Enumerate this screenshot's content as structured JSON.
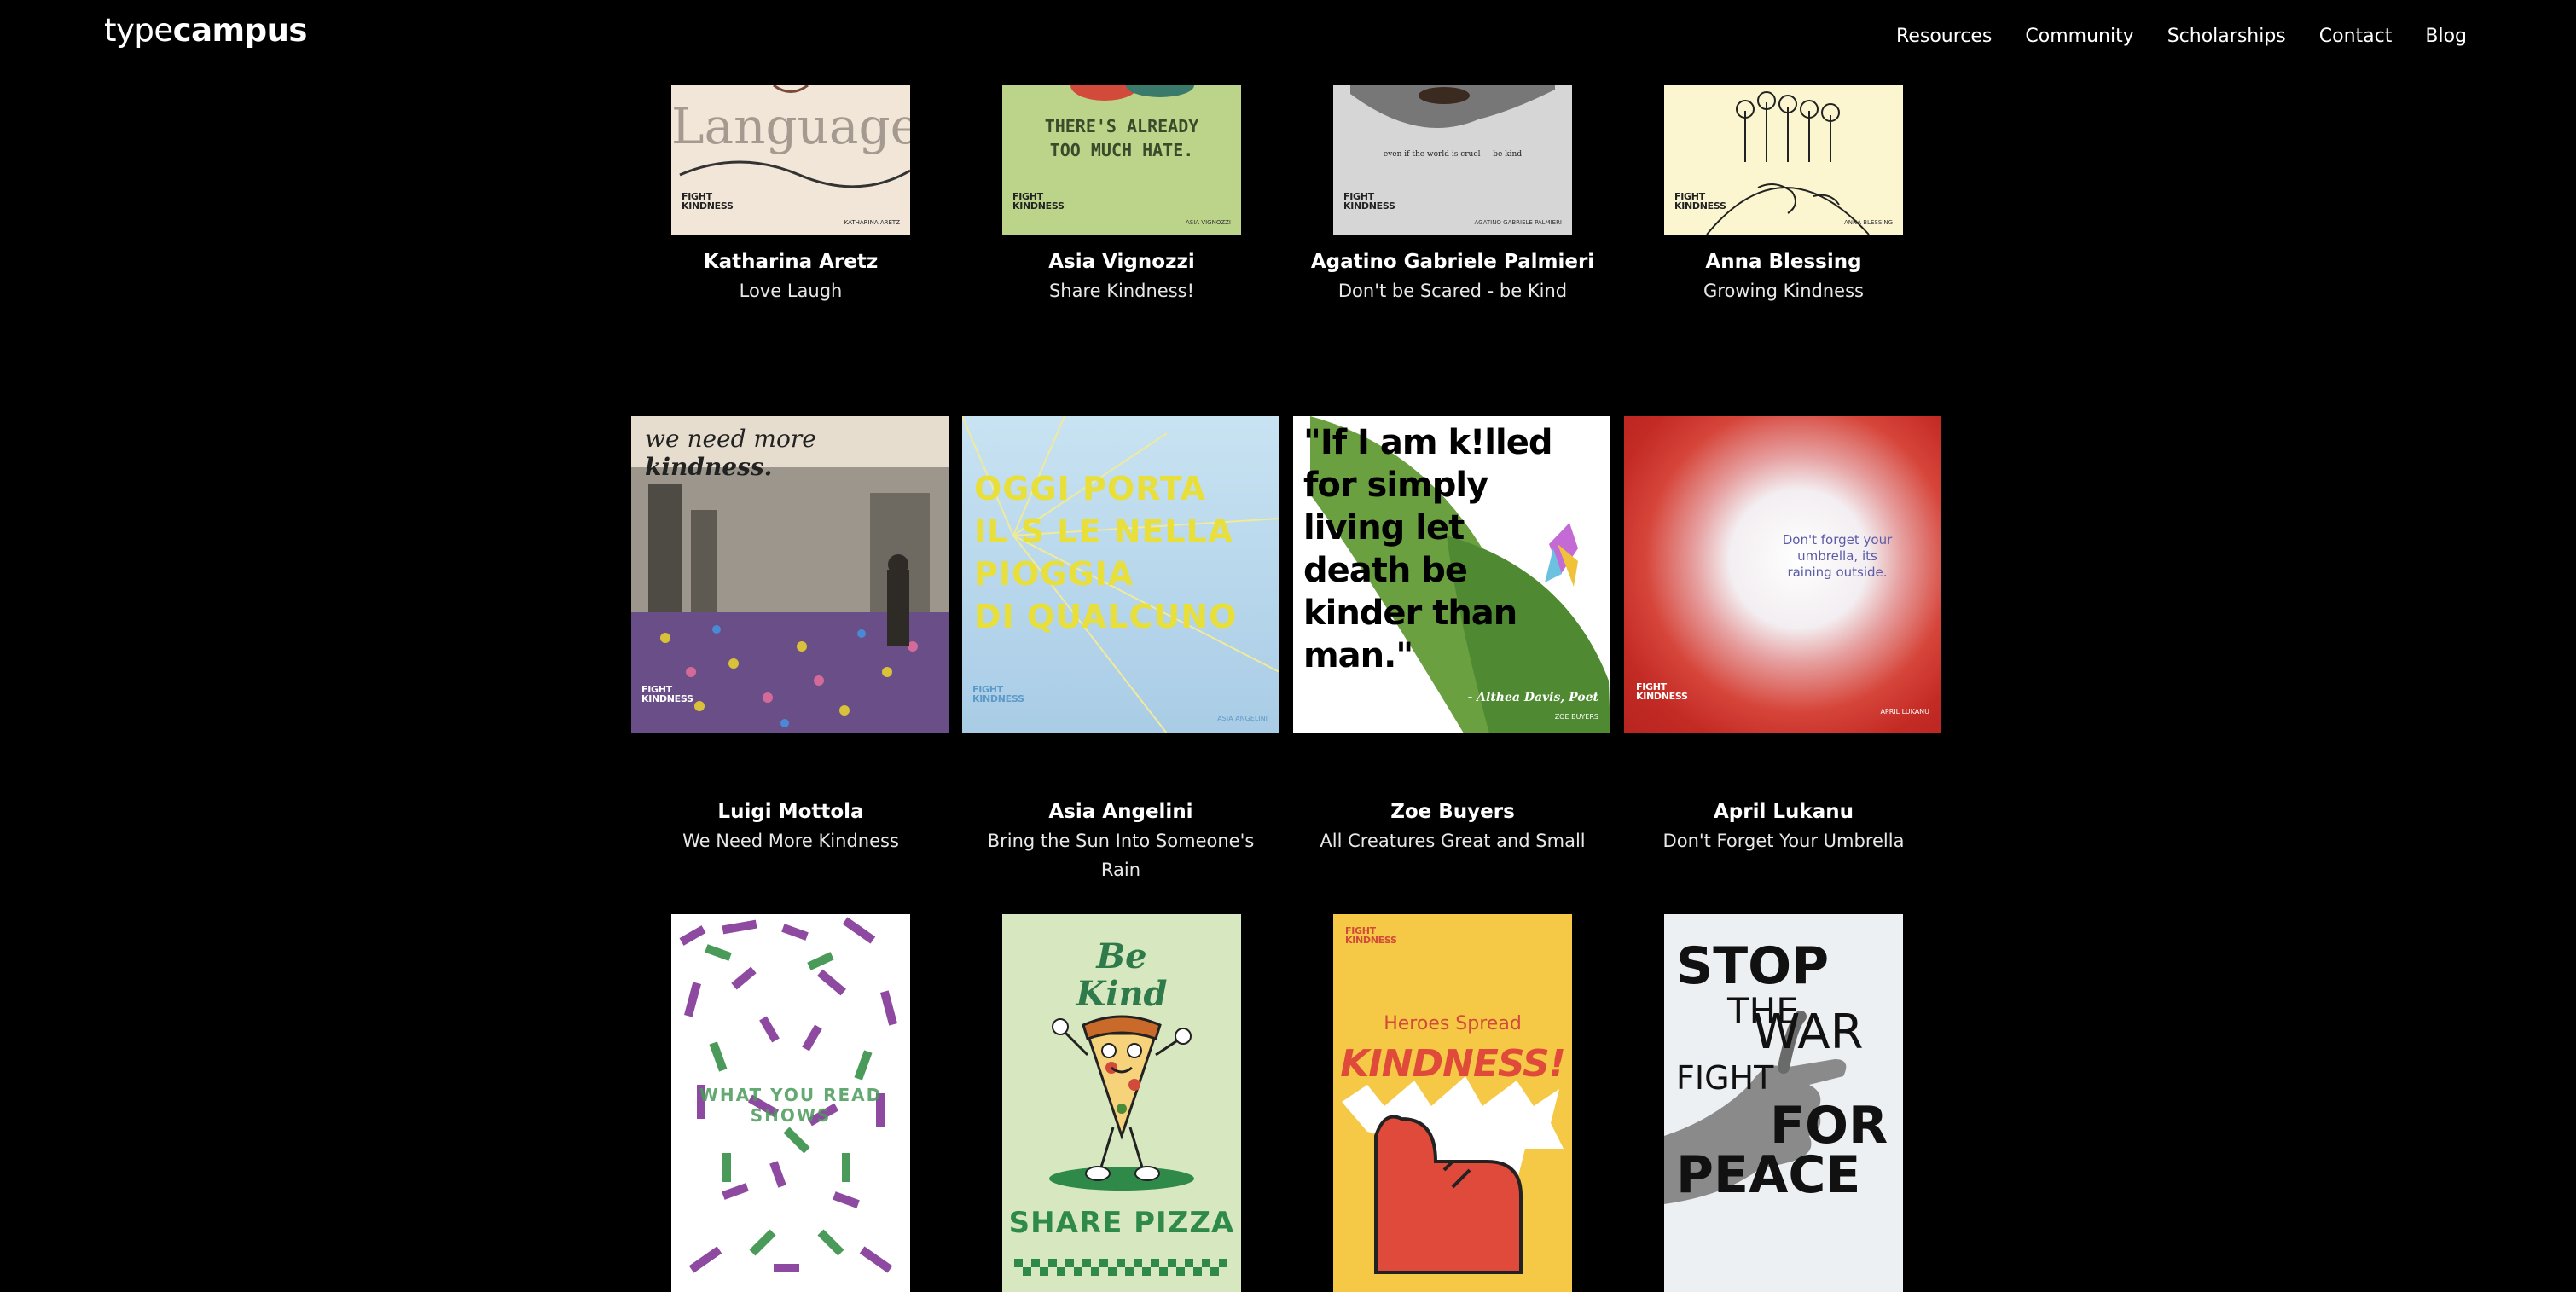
{
  "header": {
    "logo_light": "type",
    "logo_bold": "campus",
    "nav": [
      "Resources",
      "Community",
      "Scholarships",
      "Contact",
      "Blog"
    ]
  },
  "brand": {
    "badge_line1": "FIGHT",
    "badge_line2": "KINDNESS"
  },
  "row1": [
    {
      "author": "Katharina Aretz",
      "title": "Love Laugh",
      "poster_text": "Language",
      "poster_credit": "KATHARINA ARETZ"
    },
    {
      "author": "Asia Vignozzi",
      "title": "Share Kindness!",
      "poster_text": "THERE'S ALREADY TOO MUCH HATE.",
      "poster_credit": "ASIA VIGNOZZI"
    },
    {
      "author": "Agatino Gabriele Palmieri",
      "title": "Don't be Scared - be Kind",
      "poster_text": "even if the world is cruel — be kind",
      "poster_credit": "AGATINO GABRIELE PALMIERI"
    },
    {
      "author": "Anna Blessing",
      "title": "Growing Kindness",
      "poster_credit": "ANNA BLESSING"
    }
  ],
  "row2": [
    {
      "author": "Luigi Mottola",
      "title": "We Need More Kindness",
      "poster_text_a": "we need more ",
      "poster_text_b": "kindness."
    },
    {
      "author": "Asia Angelini",
      "title": "Bring the Sun Into Someone's Rain",
      "poster_lines": [
        "OGGI PORTA",
        "IL S   LE NELLA",
        "PIOGGIA",
        "DI QUALCUNO"
      ],
      "poster_credit": "ASIA ANGELINI"
    },
    {
      "author": "Zoe Buyers",
      "title": "All Creatures Great and Small",
      "poster_lines": [
        "\"If I am k!lled",
        "for simply",
        "living let",
        "death be",
        "kinder than",
        "man.\""
      ],
      "poster_quote": "- Althea Davis, Poet",
      "poster_credit": "ZOE BUYERS"
    },
    {
      "author": "April Lukanu",
      "title": "Don't Forget Your Umbrella",
      "poster_lines": [
        "Don't forget your",
        "umbrella, its",
        "raining outside."
      ],
      "poster_credit": "APRIL LUKANU"
    }
  ],
  "row3": [
    {
      "poster_text": "WHAT YOU READ SHOWS"
    },
    {
      "poster_lines": [
        "Be",
        "Kind"
      ],
      "poster_footer": "SHARE PIZZA"
    },
    {
      "poster_lines": [
        "Heroes Spread",
        "KINDNESS!"
      ]
    },
    {
      "poster_lines": [
        "STOP",
        "THE",
        "WAR",
        "FIGHT",
        "FOR",
        "PEACE"
      ]
    }
  ]
}
